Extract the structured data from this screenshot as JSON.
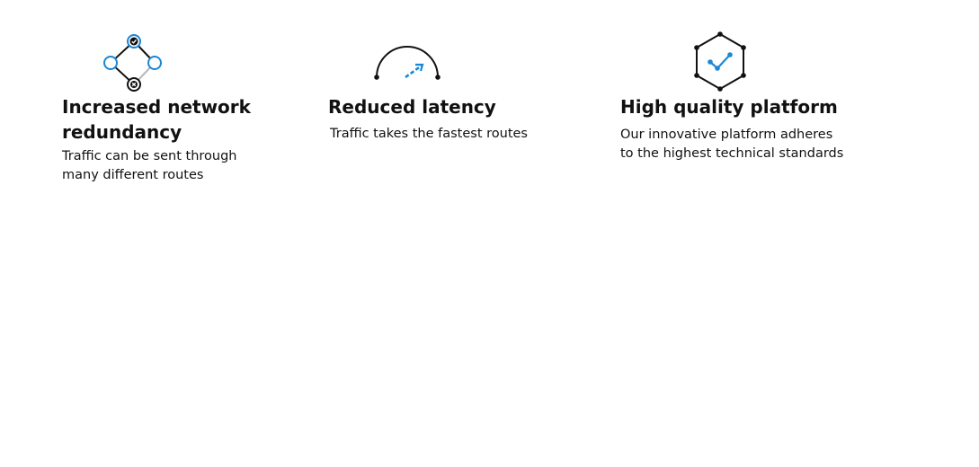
{
  "colors": {
    "accent": "#1a87d6",
    "text": "#111111",
    "muted_line": "#b8b8b8",
    "background": "#ffffff"
  },
  "features": [
    {
      "icon": "network-redundancy-icon",
      "title_line1": "Increased network",
      "title_line2": "redundancy",
      "desc_line1": "Traffic can be sent through",
      "desc_line2": "many different routes"
    },
    {
      "icon": "latency-gauge-icon",
      "title_line1": "Reduced latency",
      "desc_line1": "Traffic takes the fastest routes"
    },
    {
      "icon": "quality-hexagon-icon",
      "title_line1": "High quality platform",
      "desc_line1": "Our innovative platform adheres",
      "desc_line2": "to the highest technical standards"
    }
  ]
}
